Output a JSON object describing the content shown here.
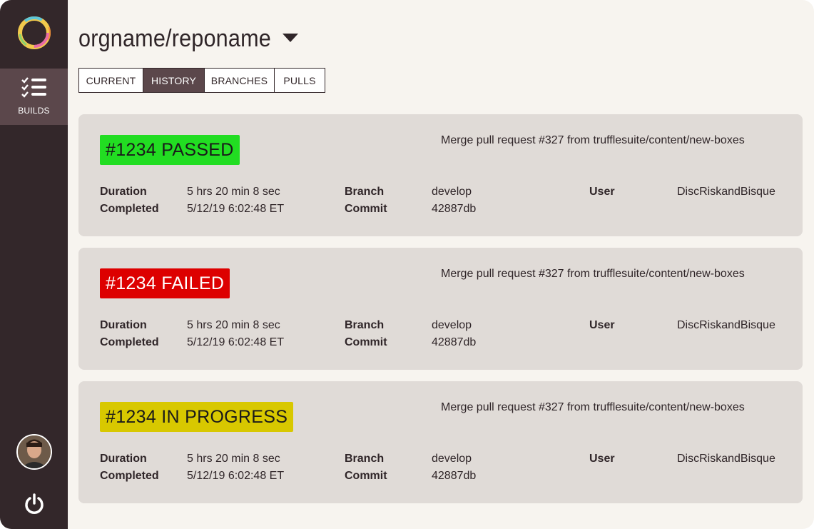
{
  "repo": {
    "title": "orgname/reponame"
  },
  "sidebar": {
    "builds_label": "BUILDS"
  },
  "tabs": [
    "CURRENT",
    "HISTORY",
    "BRANCHES",
    "PULLS"
  ],
  "active_tab": "HISTORY",
  "labels": {
    "duration": "Duration",
    "completed": "Completed",
    "branch": "Branch",
    "commit": "Commit",
    "user": "User"
  },
  "builds": [
    {
      "status_text": "#1234 PASSED",
      "status": "passed",
      "status_color": "#22dd22",
      "message": "Merge pull request #327 from trufflesuite/content/new-boxes",
      "duration": "5 hrs 20 min 8 sec",
      "completed": "5/12/19 6:02:48 ET",
      "branch": "develop",
      "commit": "42887db",
      "user": "DiscRiskandBisque"
    },
    {
      "status_text": "#1234 FAILED",
      "status": "failed",
      "status_color": "#dd0000",
      "message": "Merge pull request #327 from trufflesuite/content/new-boxes",
      "duration": "5 hrs 20 min 8 sec",
      "completed": "5/12/19 6:02:48 ET",
      "branch": "develop",
      "commit": "42887db",
      "user": "DiscRiskandBisque"
    },
    {
      "status_text": "#1234 IN PROGRESS",
      "status": "in-progress",
      "status_color": "#d8c800",
      "message": "Merge pull request #327 from trufflesuite/content/new-boxes",
      "duration": "5 hrs 20 min 8 sec",
      "completed": "5/12/19 6:02:48 ET",
      "branch": "develop",
      "commit": "42887db",
      "user": "DiscRiskandBisque"
    }
  ],
  "icons": {
    "logo": "ganache-ring-logo",
    "builds": "checklist-icon",
    "profile": "avatar",
    "power": "power-icon",
    "repo_dropdown": "caret-down-icon"
  }
}
